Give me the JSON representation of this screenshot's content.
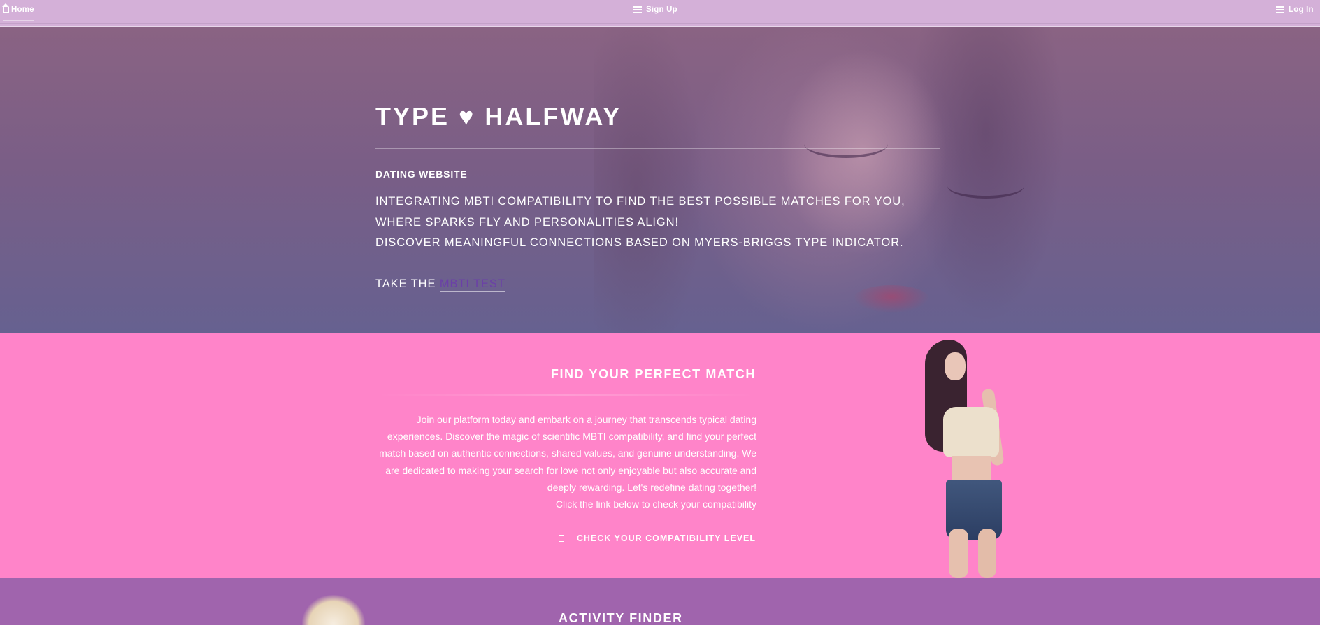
{
  "nav": {
    "home_label": "Home",
    "signup_label": "Sign Up",
    "login_label": "Log In"
  },
  "hero": {
    "title": "TYPE ♥ HALFWAY",
    "subtitle": "DATING WEBSITE",
    "line1": "INTEGRATING MBTI COMPATIBILITY TO FIND THE BEST POSSIBLE MATCHES FOR YOU,",
    "line2": "WHERE SPARKS FLY AND PERSONALITIES ALIGN!",
    "line3": "DISCOVER MEANINGFUL CONNECTIONS BASED ON MYERS-BRIGGS TYPE INDICATOR.",
    "cta_prefix": "TAKE THE ",
    "cta_link": "MBTI TEST"
  },
  "match": {
    "heading": "FIND YOUR PERFECT MATCH",
    "body": [
      "Join our platform today and embark on a journey that transcends typical dating",
      "experiences. Discover the magic of scientific MBTI compatibility, and find your perfect",
      "match based on authentic connections, shared values, and genuine understanding. We",
      "are dedicated to making your search for love not only enjoyable but also accurate and",
      "deeply rewarding. Let's redefine dating together!",
      "Click the link below to check your compatibility"
    ],
    "check_label": "CHECK YOUR COMPATIBILITY LEVEL"
  },
  "activity": {
    "heading": "ACTIVITY FINDER"
  },
  "icons": {
    "home": "home-icon",
    "menu": "hamburger-icon",
    "check": "document-icon"
  },
  "colors": {
    "nav_bg": "#d4b0d8",
    "hero_top": "#8a6383",
    "hero_bottom": "#666190",
    "pink_section": "#ff84c9",
    "purple_section": "#a064ad",
    "link": "#6b3fa8"
  }
}
